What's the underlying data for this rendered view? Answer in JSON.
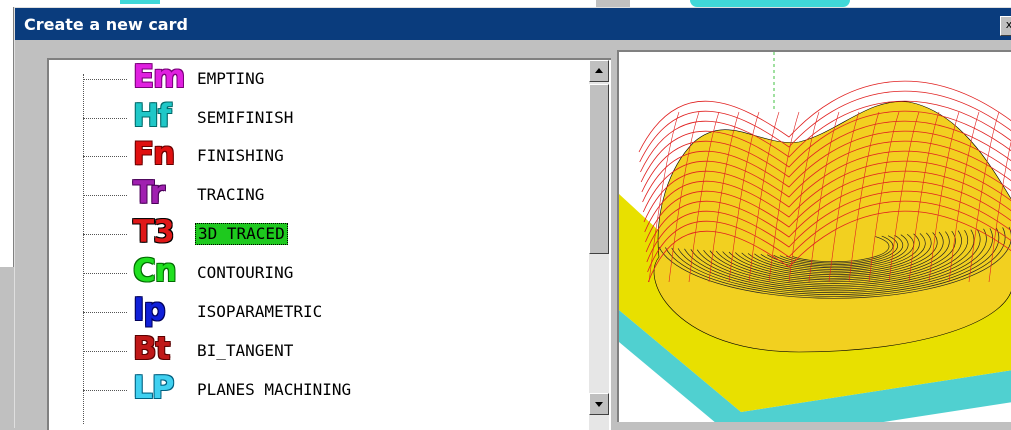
{
  "dialog": {
    "title": "Create a new card",
    "close_label": "x"
  },
  "tree": {
    "items": [
      {
        "code": "Em",
        "label": "EMPTING",
        "color": "#e020e0",
        "outline": "#7a007a",
        "selected": false
      },
      {
        "code": "Hf",
        "label": "SEMIFINISH",
        "color": "#20c8c8",
        "outline": "#006a6a",
        "selected": false
      },
      {
        "code": "Fn",
        "label": "FINISHING",
        "color": "#e01010",
        "outline": "#6a0000",
        "selected": false
      },
      {
        "code": "Tr",
        "label": "TRACING",
        "color": "#a020b0",
        "outline": "#4a0058",
        "selected": false
      },
      {
        "code": "T3",
        "label": "3D TRACED",
        "color": "#e01818",
        "outline": "#000000",
        "selected": true
      },
      {
        "code": "Cn",
        "label": "CONTOURING",
        "color": "#20e020",
        "outline": "#006a00",
        "selected": false
      },
      {
        "code": "Ip",
        "label": "ISOPARAMETRIC",
        "color": "#1020d8",
        "outline": "#00005a",
        "selected": false
      },
      {
        "code": "Bt",
        "label": "BI_TANGENT",
        "color": "#c01818",
        "outline": "#5a0000",
        "selected": false
      },
      {
        "code": "LP",
        "label": "PLANES MACHINING",
        "color": "#40d0f0",
        "outline": "#006080",
        "selected": false
      }
    ],
    "selected_highlight": "#1ec91e"
  },
  "preview": {
    "colors": {
      "surface": "#f2d020",
      "base": "#e8e000",
      "block": "#50d0d0",
      "wire": "#e02020",
      "axis": "#40c040"
    }
  }
}
